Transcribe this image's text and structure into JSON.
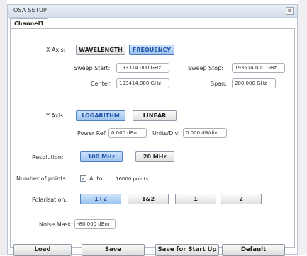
{
  "window": {
    "title": "OSA SETUP",
    "close": "⊠"
  },
  "tabs": [
    {
      "label": "Channel1"
    }
  ],
  "xaxis": {
    "label": "X Axis:",
    "options": [
      "WAVELENGTH",
      "FREQUENCY"
    ],
    "selected": "FREQUENCY",
    "sweep_start": {
      "label": "Sweep Start:",
      "value": "193314.000 GHz"
    },
    "sweep_stop": {
      "label": "Sweep Stop:",
      "value": "193514.000 GHz"
    },
    "center": {
      "label": "Center:",
      "value": "193414.000 GHz"
    },
    "span": {
      "label": "Span:",
      "value": "200.000 GHz"
    }
  },
  "yaxis": {
    "label": "Y Axis:",
    "options": [
      "LOGARITHM",
      "LINEAR"
    ],
    "selected": "LOGARITHM",
    "power_ref": {
      "label": "Power Ref:",
      "value": "0.000 dBm"
    },
    "units_div": {
      "label": "Units/Div:",
      "value": "0.000 dB/div"
    }
  },
  "resolution": {
    "label": "Resolution:",
    "options": [
      "100 MHz",
      "20 MHz"
    ],
    "selected": "100 MHz"
  },
  "points": {
    "label": "Number of points:",
    "auto_label": "Auto",
    "auto_checked": true,
    "check_mark": "✓",
    "value": "16000 points"
  },
  "polarisation": {
    "label": "Polarisation:",
    "options": [
      "1+2",
      "1&2",
      "1",
      "2"
    ],
    "selected": "1+2"
  },
  "noise_mask": {
    "label": "Noise Mask:",
    "value": "-80.000 dBm"
  },
  "footer": {
    "load": "Load",
    "save": "Save",
    "save_startup": "Save for Start Up",
    "default": "Default"
  },
  "colors": {
    "selected_bg": "#9cc3ef",
    "selected_text": "#2154a8",
    "frame": "#b4bcc8"
  }
}
